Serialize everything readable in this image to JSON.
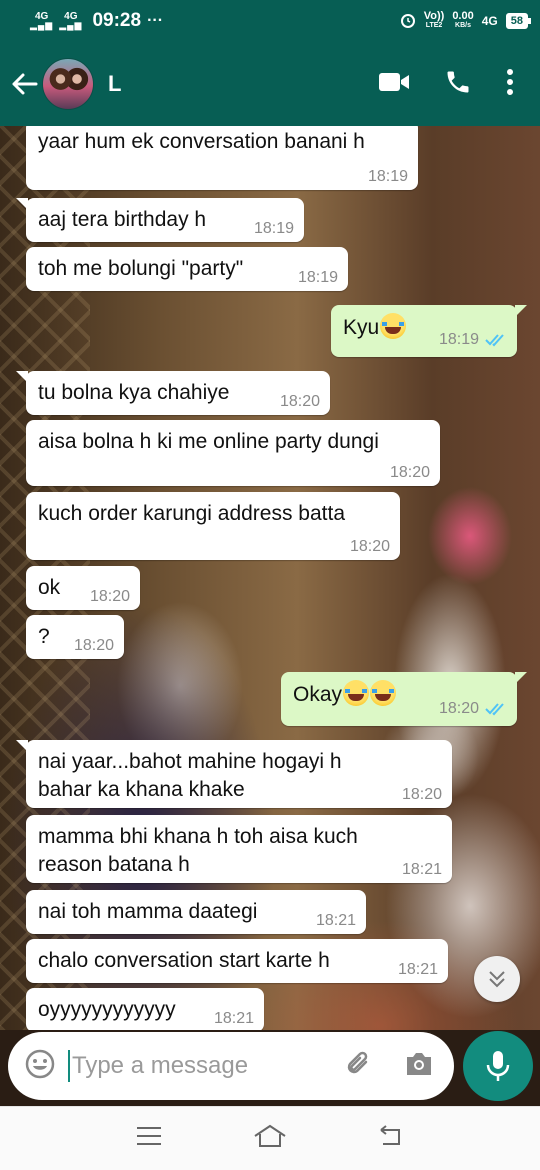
{
  "status_bar": {
    "net1": "4G",
    "net2": "4G",
    "time": "09:28",
    "dots": "···",
    "volte": "Vo))",
    "lte": "LTE2",
    "speed_value": "0.00",
    "speed_unit": "KB/s",
    "net_type": "4G",
    "battery": "58"
  },
  "header": {
    "contact_name": "L"
  },
  "messages": [
    {
      "text": "yaar hum ek conversation banani h",
      "time": "18:19"
    },
    {
      "text": "aaj tera birthday h",
      "time": "18:19"
    },
    {
      "text": "toh me bolungi \"party\"",
      "time": "18:19"
    },
    {
      "text": "Kyu",
      "time": "18:19"
    },
    {
      "text": "tu bolna kya chahiye",
      "time": "18:20"
    },
    {
      "text": "aisa bolna h ki me online party dungi",
      "time": "18:20"
    },
    {
      "text": "kuch order karungi address batta",
      "time": "18:20"
    },
    {
      "text": "ok",
      "time": "18:20"
    },
    {
      "text": "?",
      "time": "18:20"
    },
    {
      "text": "Okay",
      "time": "18:20"
    },
    {
      "text": "nai yaar...bahot mahine hogayi h\nbahar ka khana khake",
      "time": "18:20"
    },
    {
      "text": "mamma bhi khana h toh aisa kuch\nreason batana h",
      "time": "18:21"
    },
    {
      "text": "nai toh mamma daategi",
      "time": "18:21"
    },
    {
      "text": "chalo conversation start karte h",
      "time": "18:21"
    },
    {
      "text": "oyyyyyyyyyyyy",
      "time": "18:21"
    }
  ],
  "input": {
    "placeholder": "Type a message"
  },
  "colors": {
    "header": "#075e54",
    "accent": "#128c7e",
    "outgoing_bubble": "#dcf8c6",
    "read_ticks": "#4fc3f7"
  }
}
